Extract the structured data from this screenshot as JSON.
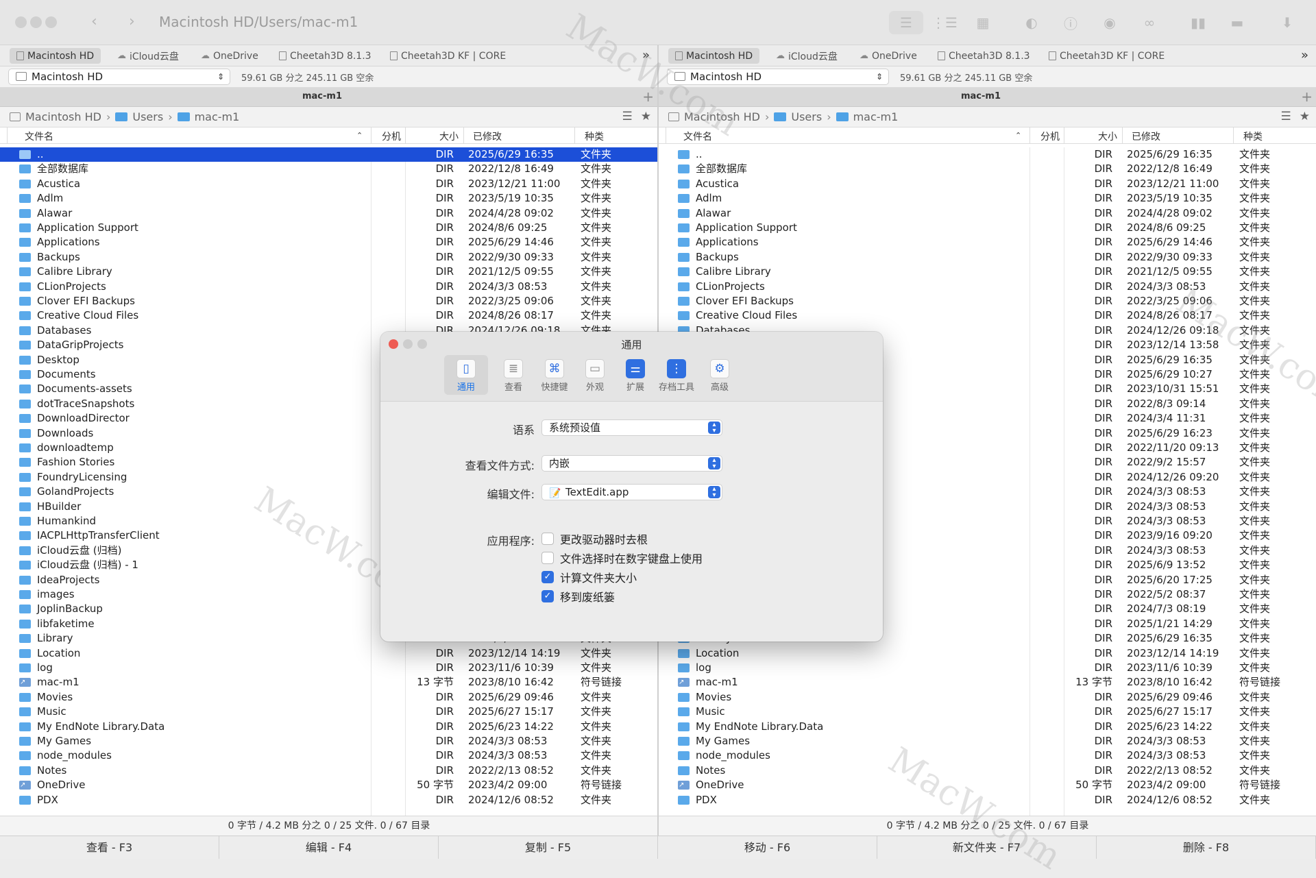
{
  "window": {
    "path_title": "Macintosh HD/Users/mac-m1"
  },
  "drives": [
    {
      "label": "Macintosh HD",
      "icon": "hd-icon"
    },
    {
      "label": "iCloud云盘",
      "icon": "cloud-icon"
    },
    {
      "label": "OneDrive",
      "icon": "cloud-icon"
    },
    {
      "label": "Cheetah3D 8.1.3",
      "icon": "disk-icon"
    },
    {
      "label": "Cheetah3D KF | CORE",
      "icon": "disk-icon"
    }
  ],
  "more_label": "»",
  "volume": {
    "name": "Macintosh HD",
    "info": "59.61 GB 分之 245.11 GB 空余"
  },
  "tab_title": "mac-m1",
  "breadcrumb": [
    "Macintosh HD",
    "Users",
    "mac-m1"
  ],
  "columns": {
    "name": "文件名",
    "ext": "分机",
    "size": "大小",
    "modified": "已修改",
    "kind": "种类"
  },
  "files": [
    {
      "name": "..",
      "size": "DIR",
      "date": "2025/6/29 16:35",
      "kind": "文件夹"
    },
    {
      "name": "全部数据库",
      "size": "DIR",
      "date": "2022/12/8 16:49",
      "kind": "文件夹"
    },
    {
      "name": "Acustica",
      "size": "DIR",
      "date": "2023/12/21 11:00",
      "kind": "文件夹"
    },
    {
      "name": "Adlm",
      "size": "DIR",
      "date": "2023/5/19 10:35",
      "kind": "文件夹"
    },
    {
      "name": "Alawar",
      "size": "DIR",
      "date": "2024/4/28 09:02",
      "kind": "文件夹"
    },
    {
      "name": "Application Support",
      "size": "DIR",
      "date": "2024/8/6 09:25",
      "kind": "文件夹"
    },
    {
      "name": "Applications",
      "size": "DIR",
      "date": "2025/6/29 14:46",
      "kind": "文件夹"
    },
    {
      "name": "Backups",
      "size": "DIR",
      "date": "2022/9/30 09:33",
      "kind": "文件夹"
    },
    {
      "name": "Calibre Library",
      "size": "DIR",
      "date": "2021/12/5 09:55",
      "kind": "文件夹"
    },
    {
      "name": "CLionProjects",
      "size": "DIR",
      "date": "2024/3/3 08:53",
      "kind": "文件夹"
    },
    {
      "name": "Clover EFI Backups",
      "size": "DIR",
      "date": "2022/3/25 09:06",
      "kind": "文件夹"
    },
    {
      "name": "Creative Cloud Files",
      "size": "DIR",
      "date": "2024/8/26 08:17",
      "kind": "文件夹"
    },
    {
      "name": "Databases",
      "size": "DIR",
      "date": "2024/12/26 09:18",
      "kind": "文件夹"
    },
    {
      "name": "DataGripProjects",
      "size": "DIR",
      "date": "2023/12/14 13:58",
      "kind": "文件夹"
    },
    {
      "name": "Desktop",
      "size": "DIR",
      "date": "2025/6/29 16:35",
      "kind": "文件夹"
    },
    {
      "name": "Documents",
      "size": "DIR",
      "date": "2025/6/29 10:27",
      "kind": "文件夹"
    },
    {
      "name": "Documents-assets",
      "size": "DIR",
      "date": "2023/10/31 15:51",
      "kind": "文件夹"
    },
    {
      "name": "dotTraceSnapshots",
      "size": "DIR",
      "date": "2022/8/3 09:14",
      "kind": "文件夹"
    },
    {
      "name": "DownloadDirector",
      "size": "DIR",
      "date": "2024/3/4 11:31",
      "kind": "文件夹"
    },
    {
      "name": "Downloads",
      "size": "DIR",
      "date": "2025/6/29 16:23",
      "kind": "文件夹"
    },
    {
      "name": "downloadtemp",
      "size": "DIR",
      "date": "2022/11/20 09:13",
      "kind": "文件夹"
    },
    {
      "name": "Fashion Stories",
      "size": "DIR",
      "date": "2022/9/2 15:57",
      "kind": "文件夹"
    },
    {
      "name": "FoundryLicensing",
      "size": "DIR",
      "date": "2024/12/26 09:20",
      "kind": "文件夹"
    },
    {
      "name": "GolandProjects",
      "size": "DIR",
      "date": "2024/3/3 08:53",
      "kind": "文件夹"
    },
    {
      "name": "HBuilder",
      "size": "DIR",
      "date": "2024/3/3 08:53",
      "kind": "文件夹"
    },
    {
      "name": "Humankind",
      "size": "DIR",
      "date": "2024/3/3 08:53",
      "kind": "文件夹"
    },
    {
      "name": "IACPLHttpTransferClient",
      "size": "DIR",
      "date": "2023/9/16 09:20",
      "kind": "文件夹"
    },
    {
      "name": "iCloud云盘 (归档)",
      "size": "DIR",
      "date": "2024/3/3 08:53",
      "kind": "文件夹"
    },
    {
      "name": "iCloud云盘 (归档) - 1",
      "size": "DIR",
      "date": "2025/6/9 13:52",
      "kind": "文件夹"
    },
    {
      "name": "IdeaProjects",
      "size": "DIR",
      "date": "2025/6/20 17:25",
      "kind": "文件夹"
    },
    {
      "name": "images",
      "size": "DIR",
      "date": "2022/5/2 08:37",
      "kind": "文件夹"
    },
    {
      "name": "JoplinBackup",
      "size": "DIR",
      "date": "2024/7/3 08:19",
      "kind": "文件夹"
    },
    {
      "name": "libfaketime",
      "size": "DIR",
      "date": "2025/1/21 14:29",
      "kind": "文件夹"
    },
    {
      "name": "Library",
      "size": "DIR",
      "date": "2025/6/29 16:35",
      "kind": "文件夹"
    },
    {
      "name": "Location",
      "size": "DIR",
      "date": "2023/12/14 14:19",
      "kind": "文件夹"
    },
    {
      "name": "log",
      "size": "DIR",
      "date": "2023/11/6 10:39",
      "kind": "文件夹"
    },
    {
      "name": "mac-m1",
      "size": "13 字节",
      "date": "2023/8/10 16:42",
      "kind": "符号链接",
      "link": true
    },
    {
      "name": "Movies",
      "size": "DIR",
      "date": "2025/6/29 09:46",
      "kind": "文件夹"
    },
    {
      "name": "Music",
      "size": "DIR",
      "date": "2025/6/27 15:17",
      "kind": "文件夹"
    },
    {
      "name": "My EndNote Library.Data",
      "size": "DIR",
      "date": "2025/6/23 14:22",
      "kind": "文件夹"
    },
    {
      "name": "My Games",
      "size": "DIR",
      "date": "2024/3/3 08:53",
      "kind": "文件夹"
    },
    {
      "name": "node_modules",
      "size": "DIR",
      "date": "2024/3/3 08:53",
      "kind": "文件夹"
    },
    {
      "name": "Notes",
      "size": "DIR",
      "date": "2022/2/13 08:52",
      "kind": "文件夹"
    },
    {
      "name": "OneDrive",
      "size": "50 字节",
      "date": "2023/4/2 09:00",
      "kind": "符号链接",
      "link": true
    },
    {
      "name": "PDX",
      "size": "DIR",
      "date": "2024/12/6 08:52",
      "kind": "文件夹"
    }
  ],
  "status_text": "0 字节 / 4.2 MB 分之 0 / 25 文件. 0 / 67 目录",
  "fkeys": [
    "查看 - F3",
    "编辑 - F4",
    "复制 - F5",
    "移动 - F6",
    "新文件夹 - F7",
    "删除 - F8"
  ],
  "dialog": {
    "title": "通用",
    "tabs": [
      {
        "label": "通用",
        "icon": "phone-icon",
        "color": "#2f6fe0"
      },
      {
        "label": "查看",
        "icon": "list-eye-icon",
        "color": "#888888"
      },
      {
        "label": "快捷键",
        "icon": "command-key-icon",
        "color": "#2f6fe0"
      },
      {
        "label": "外观",
        "icon": "window-layout-icon",
        "color": "#888888"
      },
      {
        "label": "扩展",
        "icon": "toggles-icon",
        "color": "#2f6fe0"
      },
      {
        "label": "存档工具",
        "icon": "zipper-icon",
        "color": "#2f6fe0"
      },
      {
        "label": "高级",
        "icon": "gear-icon",
        "color": "#2f6fe0"
      }
    ],
    "language_label": "语系",
    "language_value": "系统预设值",
    "view_label": "查看文件方式:",
    "view_value": "内嵌",
    "edit_label": "编辑文件:",
    "edit_value": "TextEdit.app",
    "app_label": "应用程序:",
    "options": [
      {
        "label": "更改驱动器时去根",
        "checked": false
      },
      {
        "label": "文件选择时在数字键盘上使用",
        "checked": false
      },
      {
        "label": "计算文件夹大小",
        "checked": true
      },
      {
        "label": "移到废纸篓",
        "checked": true
      }
    ]
  },
  "watermark": "MacW.com",
  "colors": {
    "selection": "#1c4fd8",
    "accent": "#2f6fe0",
    "folder": "#5aa9ea",
    "close": "#ee5b53"
  }
}
